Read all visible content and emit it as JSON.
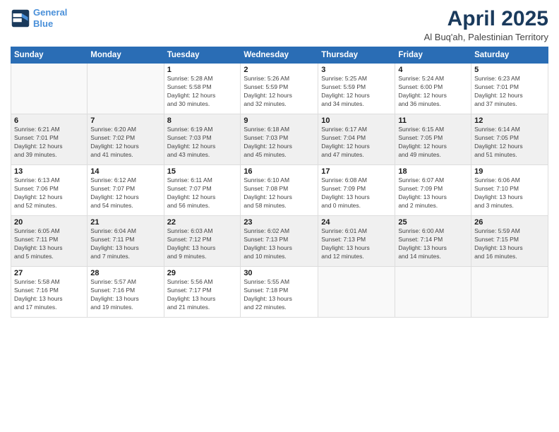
{
  "logo": {
    "line1": "General",
    "line2": "Blue"
  },
  "title": "April 2025",
  "subtitle": "Al Buq'ah, Palestinian Territory",
  "headers": [
    "Sunday",
    "Monday",
    "Tuesday",
    "Wednesday",
    "Thursday",
    "Friday",
    "Saturday"
  ],
  "weeks": [
    [
      {
        "day": "",
        "info": ""
      },
      {
        "day": "",
        "info": ""
      },
      {
        "day": "1",
        "info": "Sunrise: 5:28 AM\nSunset: 5:58 PM\nDaylight: 12 hours\nand 30 minutes."
      },
      {
        "day": "2",
        "info": "Sunrise: 5:26 AM\nSunset: 5:59 PM\nDaylight: 12 hours\nand 32 minutes."
      },
      {
        "day": "3",
        "info": "Sunrise: 5:25 AM\nSunset: 5:59 PM\nDaylight: 12 hours\nand 34 minutes."
      },
      {
        "day": "4",
        "info": "Sunrise: 5:24 AM\nSunset: 6:00 PM\nDaylight: 12 hours\nand 36 minutes."
      },
      {
        "day": "5",
        "info": "Sunrise: 6:23 AM\nSunset: 7:01 PM\nDaylight: 12 hours\nand 37 minutes."
      }
    ],
    [
      {
        "day": "6",
        "info": "Sunrise: 6:21 AM\nSunset: 7:01 PM\nDaylight: 12 hours\nand 39 minutes."
      },
      {
        "day": "7",
        "info": "Sunrise: 6:20 AM\nSunset: 7:02 PM\nDaylight: 12 hours\nand 41 minutes."
      },
      {
        "day": "8",
        "info": "Sunrise: 6:19 AM\nSunset: 7:03 PM\nDaylight: 12 hours\nand 43 minutes."
      },
      {
        "day": "9",
        "info": "Sunrise: 6:18 AM\nSunset: 7:03 PM\nDaylight: 12 hours\nand 45 minutes."
      },
      {
        "day": "10",
        "info": "Sunrise: 6:17 AM\nSunset: 7:04 PM\nDaylight: 12 hours\nand 47 minutes."
      },
      {
        "day": "11",
        "info": "Sunrise: 6:15 AM\nSunset: 7:05 PM\nDaylight: 12 hours\nand 49 minutes."
      },
      {
        "day": "12",
        "info": "Sunrise: 6:14 AM\nSunset: 7:05 PM\nDaylight: 12 hours\nand 51 minutes."
      }
    ],
    [
      {
        "day": "13",
        "info": "Sunrise: 6:13 AM\nSunset: 7:06 PM\nDaylight: 12 hours\nand 52 minutes."
      },
      {
        "day": "14",
        "info": "Sunrise: 6:12 AM\nSunset: 7:07 PM\nDaylight: 12 hours\nand 54 minutes."
      },
      {
        "day": "15",
        "info": "Sunrise: 6:11 AM\nSunset: 7:07 PM\nDaylight: 12 hours\nand 56 minutes."
      },
      {
        "day": "16",
        "info": "Sunrise: 6:10 AM\nSunset: 7:08 PM\nDaylight: 12 hours\nand 58 minutes."
      },
      {
        "day": "17",
        "info": "Sunrise: 6:08 AM\nSunset: 7:09 PM\nDaylight: 13 hours\nand 0 minutes."
      },
      {
        "day": "18",
        "info": "Sunrise: 6:07 AM\nSunset: 7:09 PM\nDaylight: 13 hours\nand 2 minutes."
      },
      {
        "day": "19",
        "info": "Sunrise: 6:06 AM\nSunset: 7:10 PM\nDaylight: 13 hours\nand 3 minutes."
      }
    ],
    [
      {
        "day": "20",
        "info": "Sunrise: 6:05 AM\nSunset: 7:11 PM\nDaylight: 13 hours\nand 5 minutes."
      },
      {
        "day": "21",
        "info": "Sunrise: 6:04 AM\nSunset: 7:11 PM\nDaylight: 13 hours\nand 7 minutes."
      },
      {
        "day": "22",
        "info": "Sunrise: 6:03 AM\nSunset: 7:12 PM\nDaylight: 13 hours\nand 9 minutes."
      },
      {
        "day": "23",
        "info": "Sunrise: 6:02 AM\nSunset: 7:13 PM\nDaylight: 13 hours\nand 10 minutes."
      },
      {
        "day": "24",
        "info": "Sunrise: 6:01 AM\nSunset: 7:13 PM\nDaylight: 13 hours\nand 12 minutes."
      },
      {
        "day": "25",
        "info": "Sunrise: 6:00 AM\nSunset: 7:14 PM\nDaylight: 13 hours\nand 14 minutes."
      },
      {
        "day": "26",
        "info": "Sunrise: 5:59 AM\nSunset: 7:15 PM\nDaylight: 13 hours\nand 16 minutes."
      }
    ],
    [
      {
        "day": "27",
        "info": "Sunrise: 5:58 AM\nSunset: 7:16 PM\nDaylight: 13 hours\nand 17 minutes."
      },
      {
        "day": "28",
        "info": "Sunrise: 5:57 AM\nSunset: 7:16 PM\nDaylight: 13 hours\nand 19 minutes."
      },
      {
        "day": "29",
        "info": "Sunrise: 5:56 AM\nSunset: 7:17 PM\nDaylight: 13 hours\nand 21 minutes."
      },
      {
        "day": "30",
        "info": "Sunrise: 5:55 AM\nSunset: 7:18 PM\nDaylight: 13 hours\nand 22 minutes."
      },
      {
        "day": "",
        "info": ""
      },
      {
        "day": "",
        "info": ""
      },
      {
        "day": "",
        "info": ""
      }
    ]
  ]
}
